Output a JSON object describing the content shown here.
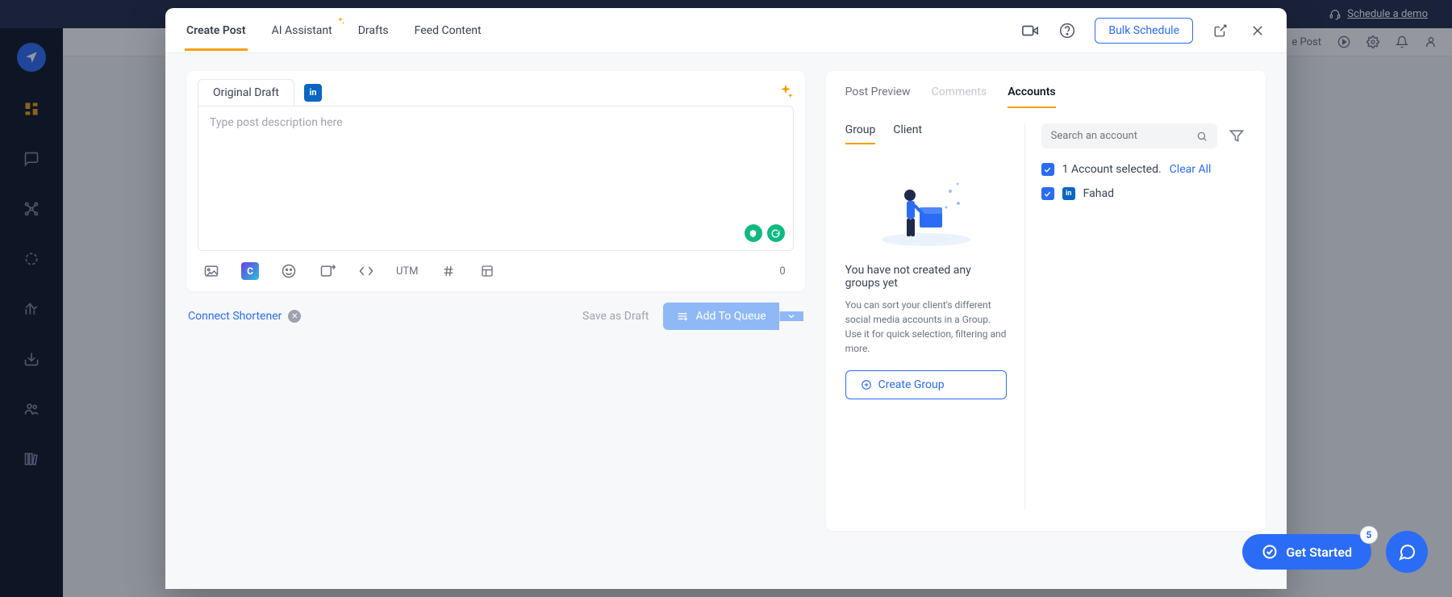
{
  "topbar": {
    "schedule_demo": "Schedule a demo"
  },
  "page_toolbar": {
    "post_label": "e Post"
  },
  "modal": {
    "tabs": {
      "create": "Create Post",
      "ai": "AI Assistant",
      "drafts": "Drafts",
      "feed": "Feed Content"
    },
    "bulk": "Bulk Schedule"
  },
  "editor": {
    "draft_tab": "Original Draft",
    "placeholder": "Type post description here",
    "utm": "UTM",
    "canva": "C",
    "char_count": "0"
  },
  "below": {
    "connect": "Connect Shortener",
    "save_draft": "Save as Draft",
    "queue": "Add To Queue"
  },
  "right": {
    "tabs": {
      "preview": "Post Preview",
      "comments": "Comments",
      "accounts": "Accounts"
    },
    "subtabs": {
      "group": "Group",
      "client": "Client"
    },
    "group_msg": "You have not created any groups yet",
    "group_desc": "You can sort your client's different social media accounts in a Group. Use it for quick selection, filtering and more.",
    "create_group": "Create Group",
    "search_placeholder": "Search an account",
    "selected_line": "1 Account selected.",
    "clear_all": "Clear All",
    "account_name": "Fahad"
  },
  "get_started": {
    "label": "Get Started",
    "badge": "5"
  }
}
